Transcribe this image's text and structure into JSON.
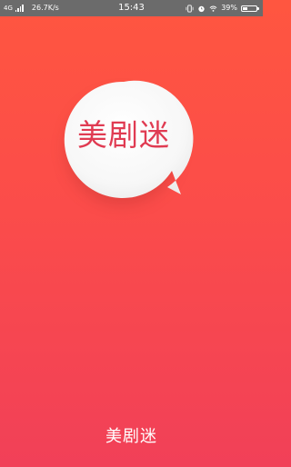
{
  "status_bar": {
    "network": "4G",
    "speed": "26.7K/s",
    "time": "15:43",
    "battery_percent": "39%",
    "battery_level": 0.39,
    "icons": [
      "signal-icon",
      "vibrate-icon",
      "alarm-icon",
      "wifi-icon",
      "battery-icon"
    ]
  },
  "splash": {
    "logo_text": "美剧迷",
    "app_name": "美剧迷"
  },
  "colors": {
    "gradient_top": "#ff5640",
    "gradient_bottom": "#f14058",
    "logo_text": "#e03b52",
    "bubble": "#fbfbfb",
    "status_bar": "#6b6b6b"
  }
}
